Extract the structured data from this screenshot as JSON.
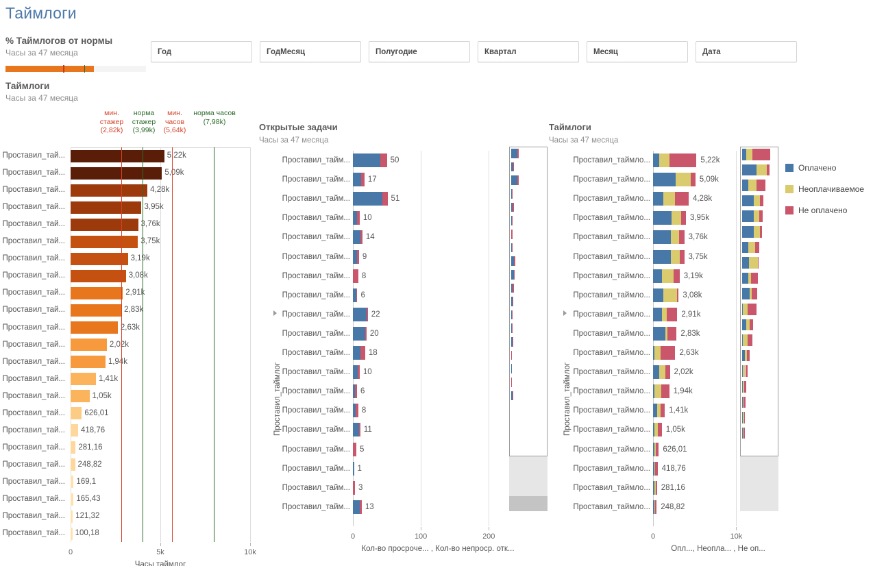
{
  "header": {
    "dashboard_title": "Таймлоги",
    "kpi_title": "% Таймлогов от нормы",
    "kpi_subtitle": "Часы за 47 месяца",
    "section_title": "Таймлоги",
    "section_subtitle": "Часы за 47 месяца",
    "bullet_fill_pct": 63,
    "bullet_tick1_pct": 41,
    "bullet_tick2_pct": 56,
    "bullet_fill_color": "#e8761d",
    "bullet_tick1_color": "#c33c2a",
    "bullet_tick2_color": "#2e6b2e"
  },
  "filters": [
    {
      "label": "Год"
    },
    {
      "label": "ГодМесяц"
    },
    {
      "label": "Полугодие"
    },
    {
      "label": "Квартал"
    },
    {
      "label": "Месяц"
    },
    {
      "label": "Дата"
    }
  ],
  "colors": {
    "paid": "#4878a8",
    "unpayable": "#d9cb6e",
    "unpaid": "#c9566b",
    "ref_red": "#d6412b",
    "ref_green": "#2b6b2b",
    "title_blue": "#4c78a8"
  },
  "reference_lines": [
    {
      "label_line1": "мин.",
      "label_line2": "стажер",
      "value_label": "(2,82k)",
      "value": 2820,
      "color": "#d6412b"
    },
    {
      "label_line1": "норма",
      "label_line2": "стажер",
      "value_label": "(3,99k)",
      "value": 3990,
      "color": "#2b6b2b"
    },
    {
      "label_line1": "мин.",
      "label_line2": "часов",
      "value_label": "(5,64k)",
      "value": 5640,
      "color": "#d6412b"
    },
    {
      "label_line1": "",
      "label_line2": "норма часов",
      "value_label": "(7,98k)",
      "value": 7980,
      "color": "#2b6b2b"
    }
  ],
  "chart_data": [
    {
      "id": "timelogs_bar",
      "type": "bar",
      "title": "Таймлоги",
      "subtitle": "Часы за 47 месяца",
      "xlabel": "Часы таймлог",
      "ylabel": "",
      "xlim": [
        0,
        10000
      ],
      "xticks": [
        "0",
        "5k",
        "10k"
      ],
      "xtick_values": [
        0,
        5000,
        10000
      ],
      "orientation": "horizontal",
      "row_label": "Проставил_тай...",
      "categories": [
        "Проставил_тай...",
        "Проставил_тай...",
        "Проставил_тай...",
        "Проставил_тай...",
        "Проставил_тай...",
        "Проставил_тай...",
        "Проставил_тай...",
        "Проставил_тай...",
        "Проставил_тай...",
        "Проставил_тай...",
        "Проставил_тай...",
        "Проставил_тай...",
        "Проставил_тай...",
        "Проставил_тай...",
        "Проставил_тай...",
        "Проставил_тай...",
        "Проставил_тай...",
        "Проставил_тай...",
        "Проставил_тай...",
        "Проставил_тай...",
        "Проставил_тай...",
        "Проставил_тай..."
      ],
      "values": [
        5220,
        5090,
        4280,
        3950,
        3760,
        3750,
        3190,
        3080,
        2910,
        2830,
        2630,
        2020,
        1940,
        1410,
        1050,
        626.01,
        418.76,
        281.16,
        248.82,
        169.1,
        165.43,
        121.32
      ],
      "value_labels": [
        "5,22k",
        "5,09k",
        "4,28k",
        "3,95k",
        "3,76k",
        "3,75k",
        "3,19k",
        "3,08k",
        "2,91k",
        "2,83k",
        "2,63k",
        "2,02k",
        "1,94k",
        "1,41k",
        "1,05k",
        "626,01",
        "418,76",
        "281,16",
        "248,82",
        "169,1",
        "165,43",
        "121,32"
      ],
      "bar_colors": [
        "#5a1e08",
        "#5a1e08",
        "#9c3a0c",
        "#9c3a0c",
        "#9c3a0c",
        "#c4510f",
        "#c4510f",
        "#c4510f",
        "#e8761d",
        "#e8761d",
        "#e8761d",
        "#f79a3e",
        "#f79a3e",
        "#fbb35c",
        "#fbb35c",
        "#fccc84",
        "#fdd79b",
        "#fdd79b",
        "#fdd79b",
        "#fde2b0",
        "#fde2b0",
        "#fde2b0"
      ],
      "extra_row": {
        "label": "Проставил_тай...",
        "value_label": "100,18",
        "value": 100.18,
        "color": "#fde2b0"
      }
    },
    {
      "id": "open_tasks_bar",
      "type": "bar",
      "title": "Открытые задачи",
      "subtitle": "Часы за 47 месяца",
      "xlabel": "Кол-во просроче... ,  Кол-во непроср. отк...",
      "ylabel": "Проставил_таймлог",
      "xlim": [
        0,
        230
      ],
      "xticks": [
        "0",
        "100",
        "200"
      ],
      "xtick_values": [
        0,
        100,
        200
      ],
      "orientation": "horizontal",
      "stacked": true,
      "series": [
        {
          "name": "Кол-во просроченных",
          "color": "#4878a8"
        },
        {
          "name": "Кол-во непросроч. открытых",
          "color": "#c9566b"
        }
      ],
      "categories": [
        "Проставил_тайм...",
        "Проставил_тайм...",
        "Проставил_тайм...",
        "Проставил_тайм...",
        "Проставил_тайм...",
        "Проставил_тайм...",
        "Проставил_тайм...",
        "Проставил_тайм...",
        "Проставил_тайм...",
        "Проставил_тайм...",
        "Проставил_тайм...",
        "Проставил_тайм...",
        "Проставил_тайм...",
        "Проставил_тайм...",
        "Проставил_тайм...",
        "Проставил_тайм...",
        "Проставил_тайм...",
        "Проставил_тайм...",
        "Проставил_тайм..."
      ],
      "values": [
        50,
        17,
        51,
        10,
        14,
        9,
        8,
        6,
        22,
        20,
        18,
        10,
        6,
        8,
        11,
        5,
        1,
        3,
        13
      ],
      "value_labels": [
        "50",
        "17",
        "51",
        "10",
        "14",
        "9",
        "8",
        "6",
        "22",
        "20",
        "18",
        "10",
        "6",
        "8",
        "11",
        "5",
        "1",
        "3",
        "13"
      ],
      "stack_values": [
        [
          40,
          10
        ],
        [
          12,
          5
        ],
        [
          43,
          8
        ],
        [
          6,
          4
        ],
        [
          11,
          3
        ],
        [
          6,
          3
        ],
        [
          0,
          8
        ],
        [
          5,
          1
        ],
        [
          20,
          2
        ],
        [
          18,
          2
        ],
        [
          11,
          7
        ],
        [
          7,
          3
        ],
        [
          3,
          3
        ],
        [
          4,
          4
        ],
        [
          9,
          2
        ],
        [
          0,
          5
        ],
        [
          1,
          0
        ],
        [
          0,
          3
        ],
        [
          10,
          3
        ]
      ]
    },
    {
      "id": "timelogs_stacked",
      "type": "bar",
      "title": "Таймлоги",
      "subtitle": "Часы за 47 месяца",
      "xlabel": "Опл...,  Неопла... ,  Не оп...",
      "ylabel": "Проставил_таймлог",
      "xlim": [
        0,
        14000
      ],
      "xticks": [
        "0",
        "10k"
      ],
      "xtick_values": [
        0,
        10000
      ],
      "orientation": "horizontal",
      "stacked": true,
      "series": [
        {
          "name": "Оплачено",
          "color": "#4878a8"
        },
        {
          "name": "Неоплачиваемое",
          "color": "#d9cb6e"
        },
        {
          "name": "Не оплачено",
          "color": "#c9566b"
        }
      ],
      "categories": [
        "Проставил_таймло...",
        "Проставил_таймло...",
        "Проставил_таймло...",
        "Проставил_таймло...",
        "Проставил_таймло...",
        "Проставил_таймло...",
        "Проставил_таймло...",
        "Проставил_таймло...",
        "Проставил_таймло...",
        "Проставил_таймло...",
        "Проставил_таймло...",
        "Проставил_таймло...",
        "Проставил_таймло...",
        "Проставил_таймло...",
        "Проставил_таймло...",
        "Проставил_таймло...",
        "Проставил_таймло...",
        "Проставил_таймло...",
        "Проставил_таймло..."
      ],
      "values": [
        5220,
        5090,
        4280,
        3950,
        3760,
        3750,
        3190,
        3080,
        2910,
        2830,
        2630,
        2020,
        1940,
        1410,
        1050,
        626.01,
        418.76,
        281.16,
        248.82
      ],
      "value_labels": [
        "5,22k",
        "5,09k",
        "4,28k",
        "3,95k",
        "3,76k",
        "3,75k",
        "3,19k",
        "3,08k",
        "2,91k",
        "2,83k",
        "2,63k",
        "2,02k",
        "1,94k",
        "1,41k",
        "1,05k",
        "626,01",
        "418,76",
        "281,16",
        "248,82"
      ],
      "stack_values": [
        [
          700,
          1250,
          3270
        ],
        [
          2700,
          1850,
          540
        ],
        [
          1200,
          1450,
          1630
        ],
        [
          2200,
          1150,
          600
        ],
        [
          2100,
          1050,
          610
        ],
        [
          2150,
          1100,
          500
        ],
        [
          1100,
          1350,
          740
        ],
        [
          1250,
          1650,
          180
        ],
        [
          1100,
          580,
          1230
        ],
        [
          1450,
          280,
          1100
        ],
        [
          80,
          820,
          1730
        ],
        [
          700,
          760,
          560
        ],
        [
          120,
          880,
          940
        ],
        [
          500,
          400,
          510
        ],
        [
          130,
          420,
          500
        ],
        [
          60,
          210,
          356
        ],
        [
          40,
          80,
          298
        ],
        [
          30,
          230,
          21
        ],
        [
          25,
          40,
          183
        ]
      ]
    }
  ],
  "legend": {
    "items": [
      {
        "label": "Оплачено",
        "color": "#4878a8"
      },
      {
        "label": "Неоплачиваемое",
        "color": "#d9cb6e"
      },
      {
        "label": "Не оплачено",
        "color": "#c9566b"
      }
    ]
  }
}
